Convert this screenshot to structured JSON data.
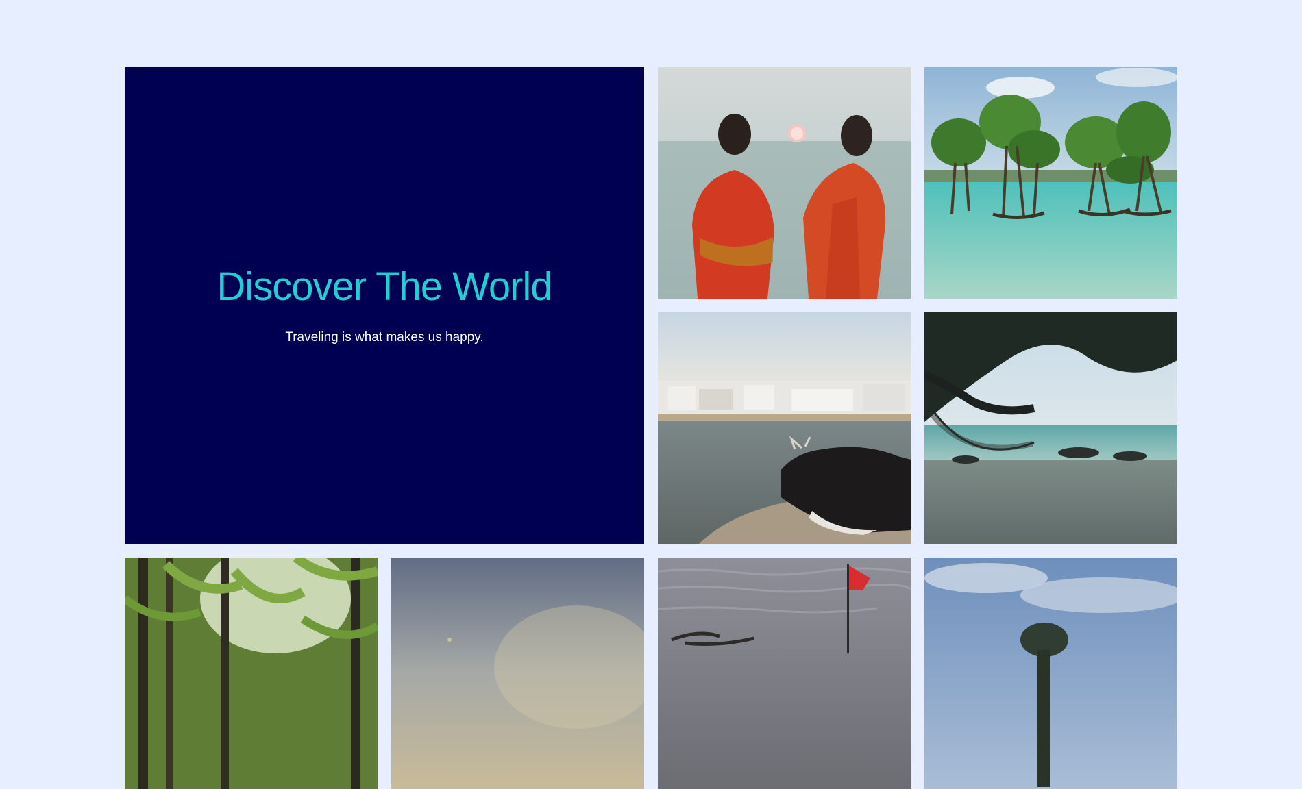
{
  "hero": {
    "title": "Discover The World",
    "subtitle": "Traveling is what makes us happy."
  },
  "colors": {
    "background": "#e6eeff",
    "hero_background": "#000052",
    "hero_title": "#1fcfd6",
    "hero_subtitle": "#ffffff"
  }
}
